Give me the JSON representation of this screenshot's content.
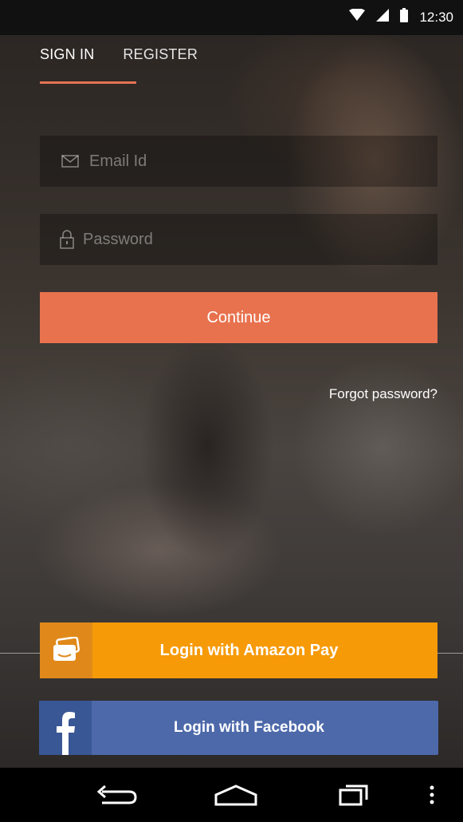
{
  "status_bar": {
    "time": "12:30",
    "icons": [
      "wifi-icon",
      "signal-icon",
      "battery-icon"
    ]
  },
  "tabs": [
    {
      "label": "SIGN IN",
      "active": true
    },
    {
      "label": "REGISTER",
      "active": false
    }
  ],
  "form": {
    "email_placeholder": "Email Id",
    "password_placeholder": "Password",
    "continue_label": "Continue",
    "forgot_label": "Forgot password?"
  },
  "social": {
    "amazon_label": "Login with Amazon Pay",
    "facebook_label": "Login with Facebook"
  },
  "nav": {
    "buttons": [
      "back-icon",
      "home-icon",
      "recents-icon",
      "menu-icon"
    ]
  },
  "colors": {
    "accent": "#e8724e",
    "amazon": "#f69a08",
    "facebook": "#4d69aa"
  }
}
